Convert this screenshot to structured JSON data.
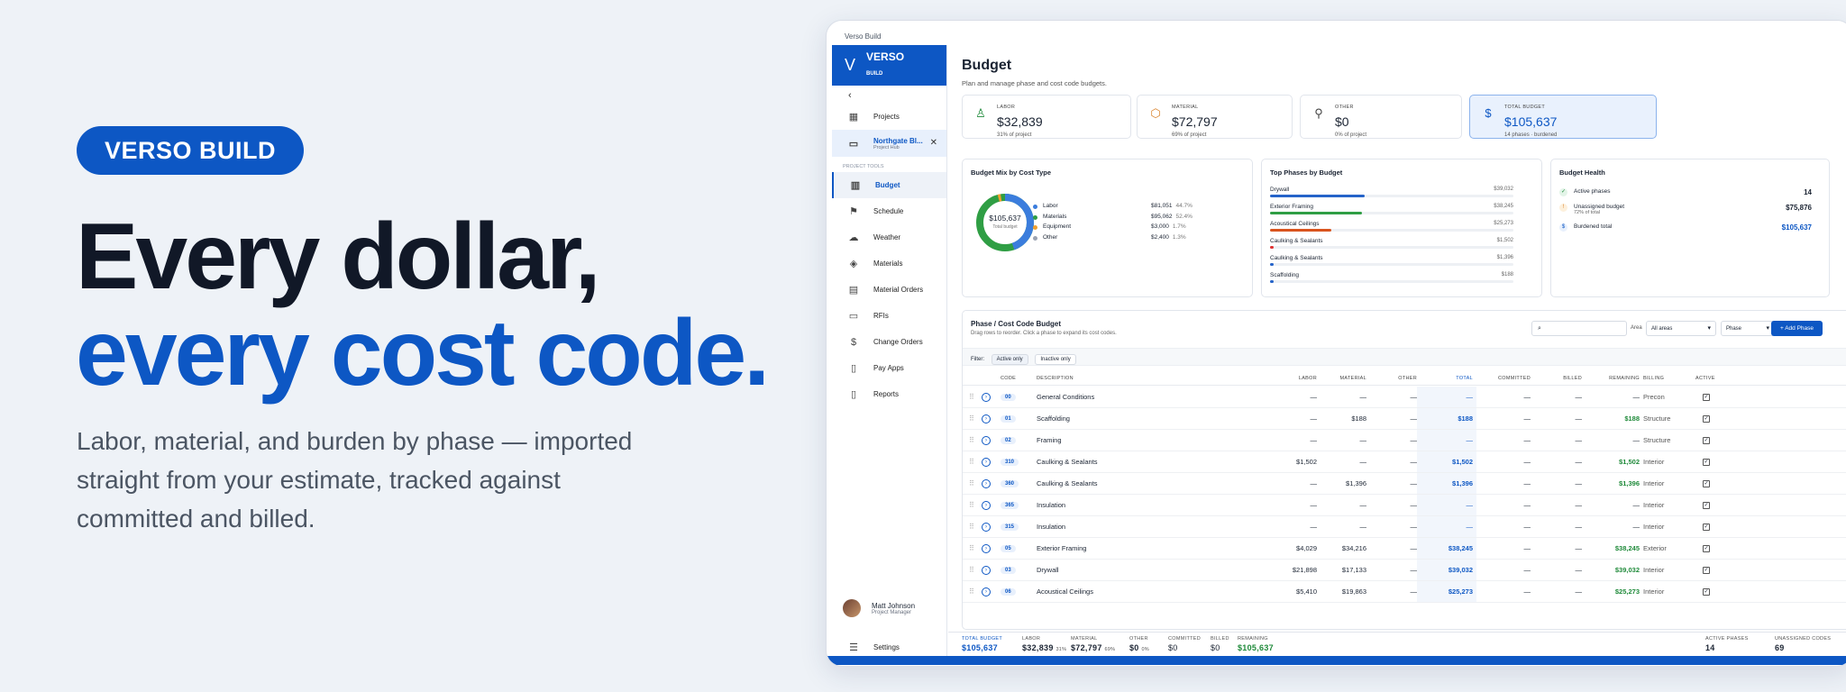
{
  "hero": {
    "badge": "VERSO BUILD",
    "headline_1": "Every dollar,",
    "headline_2": "every cost code.",
    "subtitle": "Labor, material, and burden by phase — imported straight from your estimate, tracked against committed and billed."
  },
  "window": {
    "title": "Verso Build"
  },
  "sidebar": {
    "logo_name": "VERSO",
    "logo_sub": "BUILD",
    "projects": "Projects",
    "project_name": "Northgate Bl...",
    "project_sub": "Project Hub",
    "section": "PROJECT TOOLS",
    "items": [
      "Budget",
      "Schedule",
      "Weather",
      "Materials",
      "Material Orders",
      "RFIs",
      "Change Orders",
      "Pay Apps",
      "Reports"
    ],
    "user_name": "Matt Johnson",
    "user_role": "Project Manager",
    "settings": "Settings"
  },
  "page": {
    "title": "Budget",
    "subtitle": "Plan and manage phase and cost code budgets."
  },
  "stats": [
    {
      "label": "LABOR",
      "value": "$32,839",
      "caption": "31%  of project",
      "icon": "person-icon",
      "color": "#1f8a3a"
    },
    {
      "label": "MATERIAL",
      "value": "$72,797",
      "caption": "69%  of project",
      "icon": "box-icon",
      "color": "#d9822b"
    },
    {
      "label": "OTHER",
      "value": "$0",
      "caption": "0%  of project",
      "icon": "wrench-icon",
      "color": "#444444"
    },
    {
      "label": "TOTAL BUDGET",
      "value": "$105,637",
      "caption": "14 phases · burdened",
      "icon": "dollar-icon",
      "color": "#0d57c4"
    }
  ],
  "mix": {
    "title": "Budget Mix by Cost Type",
    "center_value": "$105,637",
    "center_label": "Total budget",
    "items": [
      {
        "name": "Labor",
        "amount": "$81,051",
        "pct": "44.7%",
        "color": "#3b7ddd"
      },
      {
        "name": "Materials",
        "amount": "$95,062",
        "pct": "52.4%",
        "color": "#2f9e44"
      },
      {
        "name": "Equipment",
        "amount": "$3,000",
        "pct": "1.7%",
        "color": "#f0a030"
      },
      {
        "name": "Other",
        "amount": "$2,400",
        "pct": "1.3%",
        "color": "#9aa3b2"
      }
    ]
  },
  "top_phases": {
    "title": "Top Phases by Budget",
    "items": [
      {
        "name": "Drywall",
        "amount": "$39,032",
        "pct": 0.37,
        "color": "#2563c9"
      },
      {
        "name": "Exterior Framing",
        "amount": "$38,245",
        "pct": 0.36,
        "color": "#2f9e44"
      },
      {
        "name": "Acoustical Ceilings",
        "amount": "$25,273",
        "pct": 0.24,
        "color": "#d9541e"
      },
      {
        "name": "Caulking & Sealants",
        "amount": "$1,502",
        "pct": 0.014,
        "color": "#e03131"
      },
      {
        "name": "Caulking & Sealants",
        "amount": "$1,396",
        "pct": 0.013,
        "color": "#2563c9"
      },
      {
        "name": "Scaffolding",
        "amount": "$188",
        "pct": 0.002,
        "color": "#2563c9"
      }
    ]
  },
  "health": {
    "title": "Budget Health",
    "items": [
      {
        "label": "Active phases",
        "sub": "",
        "value": "14",
        "icon": "✓",
        "bg": "#e3f4e8",
        "fg": "#1f8a3a",
        "vcolor": "#1b2433"
      },
      {
        "label": "Unassigned budget",
        "sub": "72% of total",
        "value": "$75,876",
        "icon": "!",
        "bg": "#fdf0dc",
        "fg": "#d9822b",
        "vcolor": "#1b2433"
      },
      {
        "label": "Burdened total",
        "sub": "",
        "value": "$105,637",
        "icon": "$",
        "bg": "#e8f0fc",
        "fg": "#0d57c4",
        "vcolor": "#0d57c4"
      }
    ]
  },
  "table": {
    "title": "Phase / Cost Code Budget",
    "subtitle": "Drag rows to reorder. Click a phase to expand its cost codes.",
    "area_label": "Area",
    "area_value": "All areas",
    "group_value": "Phase",
    "add_button": "+ Add Phase",
    "filter_label": "Filter:",
    "filter_active": "Active only",
    "filter_inactive": "Inactive only",
    "headers": {
      "code": "CODE",
      "desc": "DESCRIPTION",
      "labor": "LABOR",
      "material": "MATERIAL",
      "other": "OTHER",
      "total": "TOTAL",
      "committed": "COMMITTED",
      "billed": "BILLED",
      "remaining": "REMAINING",
      "billing": "BILLING",
      "active": "ACTIVE"
    },
    "rows": [
      {
        "code": "00",
        "desc": "General Conditions",
        "labor": "—",
        "material": "—",
        "other": "—",
        "total": "—",
        "committed": "—",
        "billed": "—",
        "remaining": "—",
        "billing": "Precon"
      },
      {
        "code": "01",
        "desc": "Scaffolding",
        "labor": "—",
        "material": "$188",
        "other": "—",
        "total": "$188",
        "committed": "—",
        "billed": "—",
        "remaining": "$188",
        "billing": "Structure"
      },
      {
        "code": "02",
        "desc": "Framing",
        "labor": "—",
        "material": "—",
        "other": "—",
        "total": "—",
        "committed": "—",
        "billed": "—",
        "remaining": "—",
        "billing": "Structure"
      },
      {
        "code": "310",
        "desc": "Caulking & Sealants",
        "labor": "$1,502",
        "material": "—",
        "other": "—",
        "total": "$1,502",
        "committed": "—",
        "billed": "—",
        "remaining": "$1,502",
        "billing": "Interior"
      },
      {
        "code": "360",
        "desc": "Caulking & Sealants",
        "labor": "—",
        "material": "$1,396",
        "other": "—",
        "total": "$1,396",
        "committed": "—",
        "billed": "—",
        "remaining": "$1,396",
        "billing": "Interior"
      },
      {
        "code": "365",
        "desc": "Insulation",
        "labor": "—",
        "material": "—",
        "other": "—",
        "total": "—",
        "committed": "—",
        "billed": "—",
        "remaining": "—",
        "billing": "Interior"
      },
      {
        "code": "315",
        "desc": "Insulation",
        "labor": "—",
        "material": "—",
        "other": "—",
        "total": "—",
        "committed": "—",
        "billed": "—",
        "remaining": "—",
        "billing": "Interior"
      },
      {
        "code": "05",
        "desc": "Exterior Framing",
        "labor": "$4,029",
        "material": "$34,216",
        "other": "—",
        "total": "$38,245",
        "committed": "—",
        "billed": "—",
        "remaining": "$38,245",
        "billing": "Exterior"
      },
      {
        "code": "03",
        "desc": "Drywall",
        "labor": "$21,898",
        "material": "$17,133",
        "other": "—",
        "total": "$39,032",
        "committed": "—",
        "billed": "—",
        "remaining": "$39,032",
        "billing": "Interior"
      },
      {
        "code": "06",
        "desc": "Acoustical Ceilings",
        "labor": "$5,410",
        "material": "$19,863",
        "other": "—",
        "total": "$25,273",
        "committed": "—",
        "billed": "—",
        "remaining": "$25,273",
        "billing": "Interior"
      }
    ]
  },
  "footer": {
    "total_label": "TOTAL BUDGET",
    "total_value": "$105,637",
    "labor_label": "LABOR",
    "labor_value": "$32,839",
    "labor_pct": "31%",
    "material_label": "MATERIAL",
    "material_value": "$72,797",
    "material_pct": "69%",
    "other_label": "OTHER",
    "other_value": "$0",
    "other_pct": "0%",
    "committed_label": "COMMITTED",
    "committed_value": "$0",
    "billed_label": "BILLED",
    "billed_value": "$0",
    "remaining_label": "REMAINING",
    "remaining_value": "$105,637",
    "active_label": "ACTIVE PHASES",
    "active_value": "14",
    "unassigned_label": "UNASSIGNED CODES",
    "unassigned_value": "69"
  }
}
